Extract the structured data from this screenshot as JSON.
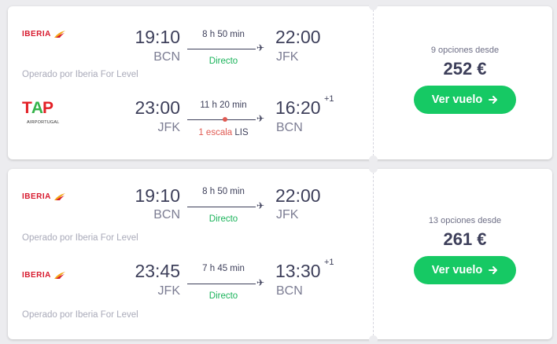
{
  "results": [
    {
      "legs": [
        {
          "airline": "IBERIA",
          "dep_time": "19:10",
          "dep_code": "BCN",
          "duration": "8 h 50 min",
          "stops": "Directo",
          "arr_time": "22:00",
          "arr_code": "JFK",
          "operated": "Operado por Iberia For Level"
        },
        {
          "airline_main": "TAP",
          "airline_sub": "AIRPORTUGAL",
          "dep_time": "23:00",
          "dep_code": "JFK",
          "duration": "11 h 20 min",
          "stops": "1 escala",
          "stop_airport": "LIS",
          "arr_time": "16:20",
          "arr_plus": "+1",
          "arr_code": "BCN"
        }
      ],
      "options": "9 opciones desde",
      "price": "252 €",
      "button": "Ver vuelo"
    },
    {
      "legs": [
        {
          "airline": "IBERIA",
          "dep_time": "19:10",
          "dep_code": "BCN",
          "duration": "8 h 50 min",
          "stops": "Directo",
          "arr_time": "22:00",
          "arr_code": "JFK",
          "operated": "Operado por Iberia For Level"
        },
        {
          "airline": "IBERIA",
          "dep_time": "23:45",
          "dep_code": "JFK",
          "duration": "7 h 45 min",
          "stops": "Directo",
          "arr_time": "13:30",
          "arr_plus": "+1",
          "arr_code": "BCN",
          "operated": "Operado por Iberia For Level"
        }
      ],
      "options": "13 opciones desde",
      "price": "261 €",
      "button": "Ver vuelo"
    }
  ],
  "colors": {
    "accent_green": "#16c964",
    "direct_green": "#1ab35a",
    "stop_red": "#e05a52",
    "iberia_red": "#d7192d"
  },
  "icons": {
    "plane": "plane-icon",
    "arrow": "arrow-right-icon"
  }
}
